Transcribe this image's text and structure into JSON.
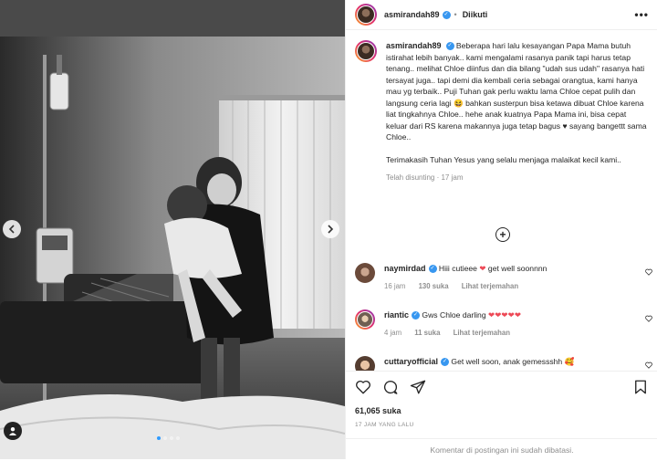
{
  "header": {
    "username": "asmirandah89",
    "follow_status": "Diikuti",
    "more_label": "•••"
  },
  "caption": {
    "username": "asmirandah89",
    "text": "Beberapa hari lalu kesayangan Papa Mama butuh istirahat lebih banyak.. kami mengalami rasanya panik tapi harus tetap tenang.. melihat Chloe diinfus dan dia bilang \"udah sus udah\" rasanya hati tersayat juga.. tapi demi dia kembali ceria sebagai orangtua, kami hanya mau yg terbaik.. Puji Tuhan gak perlu waktu lama Chloe cepat pulih dan langsung ceria lagi 😆 bahkan susterpun bisa ketawa dibuat Chloe karena liat tingkahnya Chloe.. hehe anak kuatnya Papa Mama ini, bisa cepat keluar dari RS karena makannya juga tetap bagus ♥ sayang bangettt sama Chloe..",
    "text2": "Terimakasih Tuhan Yesus yang selalu menjaga malaikat kecil kami..",
    "meta": "Telah disunting · 17 jam"
  },
  "load_more_label": "+",
  "comments": [
    {
      "username": "naymirdad",
      "text": "Hiii cutieee ❤ get well soonnnn",
      "time": "16 jam",
      "likes": "130 suka",
      "translate": "Lihat terjemahan"
    },
    {
      "username": "riantic",
      "text": "Gws Chloe darling ❤❤❤❤❤",
      "time": "4 jam",
      "likes": "11 suka",
      "translate": "Lihat terjemahan"
    },
    {
      "username": "cuttaryofficial",
      "text": "Get well soon, anak gemessshh 🥰",
      "time": "",
      "likes": "",
      "translate": ""
    }
  ],
  "likes_count": "61,065 suka",
  "post_date": "17 JAM YANG LALU",
  "comments_disabled": "Komentar di postingan ini sudah dibatasi.",
  "icons": {
    "like": "heart-icon",
    "comment": "comment-icon",
    "share": "share-icon",
    "save": "bookmark-icon",
    "prev": "chevron-left-icon",
    "next": "chevron-right-icon",
    "tag": "user-tag-icon"
  },
  "colors": {
    "verified": "#3897f0",
    "heart": "#ed4956",
    "active_dot": "#2f9bff"
  }
}
